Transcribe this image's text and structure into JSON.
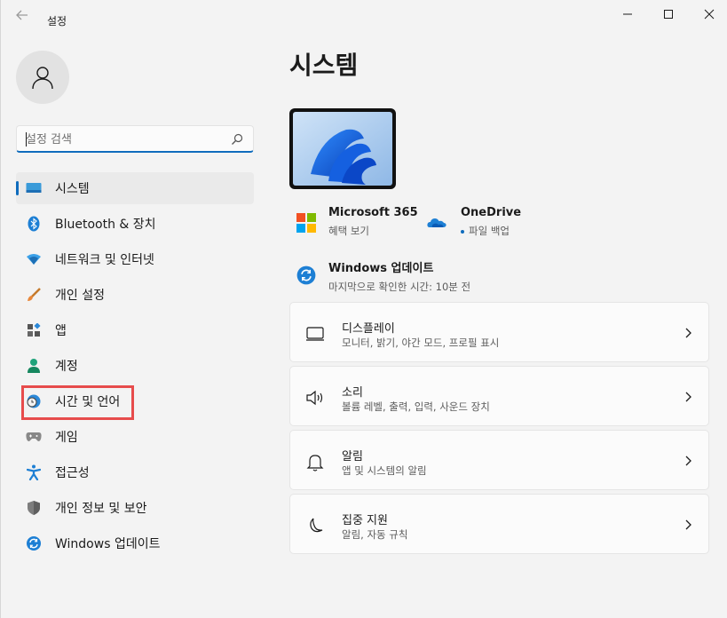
{
  "window": {
    "title": "설정"
  },
  "sidebar": {
    "search_placeholder": "설정 검색",
    "items": [
      {
        "label": "시스템",
        "icon": "system-icon",
        "active": true
      },
      {
        "label": "Bluetooth & 장치",
        "icon": "bluetooth-icon"
      },
      {
        "label": "네트워크 및 인터넷",
        "icon": "network-icon"
      },
      {
        "label": "개인 설정",
        "icon": "personalization-brush-icon"
      },
      {
        "label": "앱",
        "icon": "apps-icon"
      },
      {
        "label": "계정",
        "icon": "account-icon"
      },
      {
        "label": "시간 및 언어",
        "icon": "time-language-icon",
        "highlighted": true
      },
      {
        "label": "게임",
        "icon": "gaming-controller-icon"
      },
      {
        "label": "접근성",
        "icon": "accessibility-icon"
      },
      {
        "label": "개인 정보 및 보안",
        "icon": "privacy-shield-icon"
      },
      {
        "label": "Windows 업데이트",
        "icon": "windows-update-icon"
      }
    ]
  },
  "main": {
    "title": "시스템",
    "quick": {
      "m365": {
        "title": "Microsoft 365",
        "sub": "혜택 보기"
      },
      "onedrive": {
        "title": "OneDrive",
        "sub": "파일 백업"
      },
      "update": {
        "title": "Windows 업데이트",
        "sub": "마지막으로 확인한 시간: 10분 전"
      }
    },
    "cards": [
      {
        "title": "디스플레이",
        "sub": "모니터, 밝기, 야간 모드, 프로필 표시",
        "icon": "display-monitor-icon"
      },
      {
        "title": "소리",
        "sub": "볼륨 레벨, 출력, 입력, 사운드 장치",
        "icon": "speaker-icon"
      },
      {
        "title": "알림",
        "sub": "앱 및 시스템의 알림",
        "icon": "bell-icon"
      },
      {
        "title": "집중 지원",
        "sub": "알림, 자동 규칙",
        "icon": "moon-icon"
      }
    ]
  },
  "colors": {
    "accent": "#0f6cbd",
    "highlight": "#e74c4c",
    "background": "#f3f3f3"
  }
}
